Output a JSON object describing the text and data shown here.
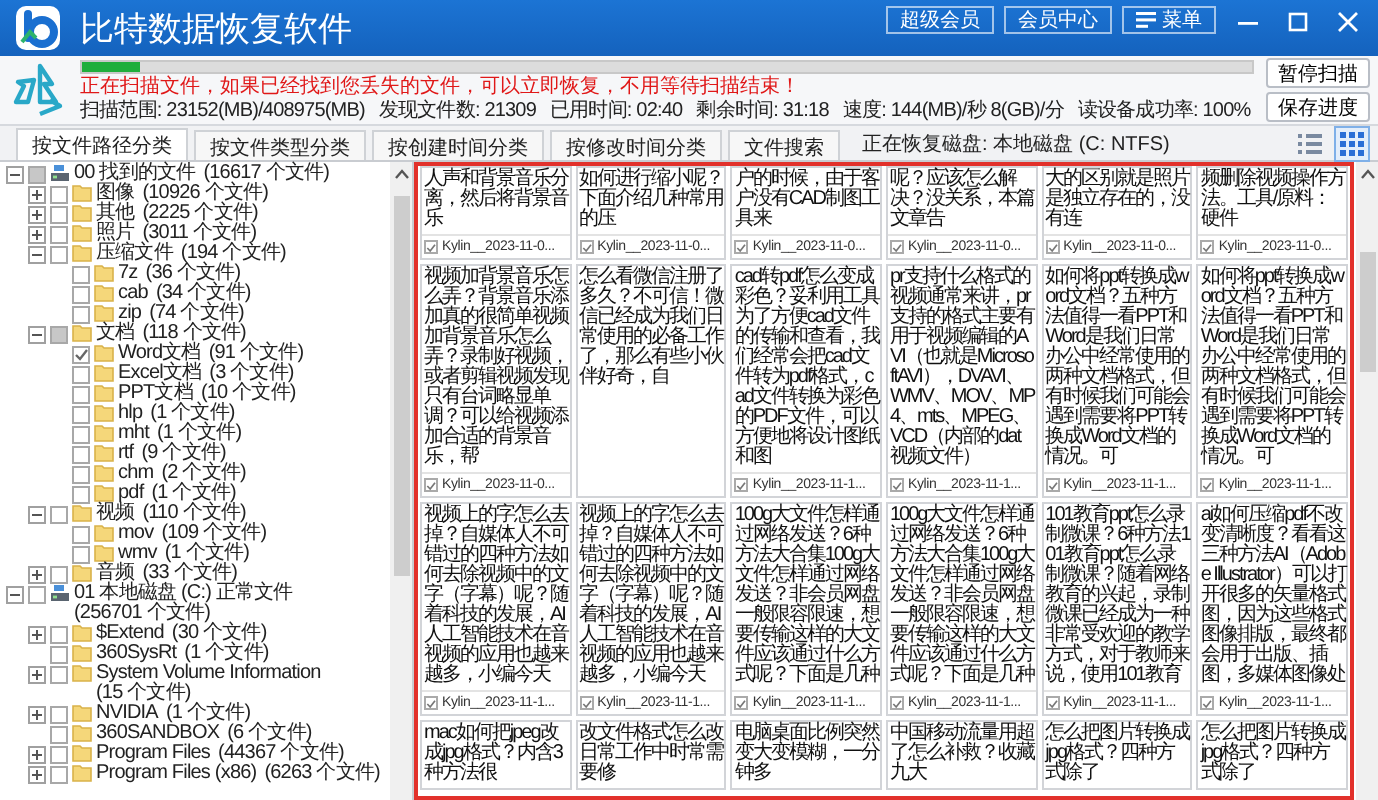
{
  "app": {
    "title": "比特数据恢复软件",
    "buttons": [
      {
        "label": "超级会员",
        "kind": "plain"
      },
      {
        "label": "会员中心",
        "kind": "plain"
      },
      {
        "label": "菜单",
        "kind": "menu"
      }
    ]
  },
  "scan": {
    "level": 0.05,
    "message": "正在扫描文件，如果已经找到您丢失的文件，可以立即恢复，不用等待扫描结束！",
    "stats": [
      "扫描范围: 23152(MB)/408975(MB)",
      "发现文件数: 21309",
      "已用时间: 02:40",
      "剩余时间: 31:18",
      "速度: 144(MB)/秒 8(GB)/分",
      "读设备成功率: 100%"
    ],
    "buttons": [
      "暂停扫描",
      "保存进度"
    ]
  },
  "tabs": [
    {
      "label": "按文件路径分类",
      "selected": true
    },
    {
      "label": "按文件类型分类",
      "selected": false
    },
    {
      "label": "按创建时间分类",
      "selected": false
    },
    {
      "label": "按修改时间分类",
      "selected": false
    },
    {
      "label": "文件搜索",
      "selected": false
    }
  ],
  "disk_status": "正在恢复磁盘: 本地磁盘 (C: NTFS)",
  "view_modes": [
    {
      "kind": "list",
      "selected": false
    },
    {
      "kind": "grid",
      "selected": true
    }
  ],
  "tree": [
    {
      "label": "00 找到的文件",
      "count": "(16617 个文件)",
      "kind": "drive",
      "checked": false,
      "partial": true,
      "expanded": true,
      "children": [
        {
          "label": "图像",
          "count": "(10926 个文件)",
          "kind": "folder",
          "checked": false,
          "partial": false,
          "expanded": false
        },
        {
          "label": "其他",
          "count": "(2225 个文件)",
          "kind": "folder",
          "checked": false,
          "partial": false,
          "expanded": false
        },
        {
          "label": "照片",
          "count": "(3011 个文件)",
          "kind": "folder",
          "checked": false,
          "partial": false,
          "expanded": false
        },
        {
          "label": "压缩文件",
          "count": "(194 个文件)",
          "kind": "folder",
          "checked": false,
          "partial": false,
          "expanded": true,
          "children": [
            {
              "label": "7z",
              "count": "(36 个文件)",
              "kind": "folder",
              "checked": false,
              "partial": false
            },
            {
              "label": "cab",
              "count": "(34 个文件)",
              "kind": "folder",
              "checked": false,
              "partial": false
            },
            {
              "label": "zip",
              "count": "(74 个文件)",
              "kind": "folder",
              "checked": false,
              "partial": false
            }
          ]
        },
        {
          "label": "文档",
          "count": "(118 个文件)",
          "kind": "folder",
          "checked": false,
          "partial": true,
          "expanded": true,
          "children": [
            {
              "label": "Word文档",
              "count": "(91 个文件)",
              "kind": "folder",
              "checked": true,
              "partial": false
            },
            {
              "label": "Excel文档",
              "count": "(3 个文件)",
              "kind": "folder",
              "checked": false,
              "partial": false
            },
            {
              "label": "PPT文档",
              "count": "(10 个文件)",
              "kind": "folder",
              "checked": false,
              "partial": false
            },
            {
              "label": "hlp",
              "count": "(1 个文件)",
              "kind": "folder",
              "checked": false,
              "partial": false
            },
            {
              "label": "mht",
              "count": "(1 个文件)",
              "kind": "folder",
              "checked": false,
              "partial": false
            },
            {
              "label": "rtf",
              "count": "(9 个文件)",
              "kind": "folder",
              "checked": false,
              "partial": false
            },
            {
              "label": "chm",
              "count": "(2 个文件)",
              "kind": "folder",
              "checked": false,
              "partial": false
            },
            {
              "label": "pdf",
              "count": "(1 个文件)",
              "kind": "folder",
              "checked": false,
              "partial": false
            }
          ]
        },
        {
          "label": "视频",
          "count": "(110 个文件)",
          "kind": "folder",
          "checked": false,
          "partial": false,
          "expanded": true,
          "children": [
            {
              "label": "mov",
              "count": "(109 个文件)",
              "kind": "folder",
              "checked": false,
              "partial": false
            },
            {
              "label": "wmv",
              "count": "(1 个文件)",
              "kind": "folder",
              "checked": false,
              "partial": false
            }
          ]
        },
        {
          "label": "音频",
          "count": "(33 个文件)",
          "kind": "folder",
          "checked": false,
          "partial": false,
          "expanded": false
        }
      ]
    },
    {
      "label": "01 本地磁盘 (C:) 正常文件",
      "count": "(256701 个文件)",
      "kind": "drive",
      "checked": false,
      "partial": false,
      "expanded": true,
      "children": [
        {
          "label": "$Extend",
          "count": "(30 个文件)",
          "kind": "folder",
          "checked": false,
          "partial": false,
          "expanded": false
        },
        {
          "label": "360SysRt",
          "count": "(1 个文件)",
          "kind": "folder",
          "checked": false,
          "partial": false
        },
        {
          "label": "System Volume Information",
          "count": "(15 个文件)",
          "kind": "folder",
          "checked": false,
          "partial": false,
          "expanded": false
        },
        {
          "label": "NVIDIA",
          "count": "(1 个文件)",
          "kind": "folder",
          "checked": false,
          "partial": false,
          "expanded": false
        },
        {
          "label": "360SANDBOX",
          "count": "(6 个文件)",
          "kind": "folder",
          "checked": false,
          "partial": false
        },
        {
          "label": "Program Files",
          "count": "(44367 个文件)",
          "kind": "folder",
          "checked": false,
          "partial": false,
          "expanded": false
        },
        {
          "label": "Program Files (x86)",
          "count": "(6263 个文件)",
          "kind": "folder",
          "checked": false,
          "partial": false,
          "expanded": false
        }
      ]
    }
  ],
  "cards": [
    {
      "text": "人声和背景音乐分离，然后将背景音乐",
      "footer": "Kylin__2023-11-0...",
      "checked": true
    },
    {
      "text": "如何进行缩小呢？下面介绍几种常用的压",
      "footer": "Kylin__2023-11-0...",
      "checked": true
    },
    {
      "text": "户的时候，由于客户没有CAD制图工具来",
      "footer": "Kylin__2023-11-0...",
      "checked": true
    },
    {
      "text": "呢？应该怎么解决？没关系，本篇文章告",
      "footer": "Kylin__2023-11-0...",
      "checked": true
    },
    {
      "text": "大的区别就是照片是独立存在的，没有连",
      "footer": "Kylin__2023-11-0...",
      "checked": true
    },
    {
      "text": "频删除视频操作方法。工具/原料：硬件",
      "footer": "Kylin__2023-11-0...",
      "checked": true
    },
    {
      "text": "视频加背景音乐怎么弄？背景音乐添加真的很简单视频加背景音乐怎么弄？录制好视频，或者剪辑视频发现只有台词略显单调？可以给视频添加合适的背景音乐，帮",
      "footer": "Kylin__2023-11-0...",
      "checked": true
    },
    {
      "text": "怎么看微信注册了多久？不可信！微信已经成为我们日常使用的必备工作了，那么有些小伙伴好奇，自"
    },
    {
      "text": "cad转pdf怎么变成彩色？妥利用工具为了方便cad文件的传输和查看，我们经常会把cad文件转为pdf格式，cad文件转换为彩色的PDF文件，可以方便地将设计图纸和图",
      "footer": "Kylin__2023-11-1...",
      "checked": true
    },
    {
      "text": "pr支持什么格式的视频通常来讲，pr支持的格式主要有用于视频编辑的AVI（也就是MicrosoftAVI），DVAVI、WMV、MOV、MP4、mts、MPEG、VCD（内部的dat视频文件）",
      "footer": "Kylin__2023-11-1...",
      "checked": true
    },
    {
      "text": "如何将ppt转换成word文档？五种方法值得一看PPT和Word是我们日常办公中经常使用的两种文档格式，但有时候我们可能会遇到需要将PPT转换成Word文档的情况。可",
      "footer": "Kylin__2023-11-1...",
      "checked": true
    },
    {
      "text": "如何将ppt转换成word文档？五种方法值得一看PPT和Word是我们日常办公中经常使用的两种文档格式，但有时候我们可能会遇到需要将PPT转换成Word文档的情况。可",
      "footer": "Kylin__2023-11-1...",
      "checked": true
    },
    {
      "text": "视频上的字怎么去掉？自媒体人不可错过的四种方法如何去除视频中的文字（字幕）呢？随着科技的发展，AI人工智能技术在音视频的应用也越来越多，小编今天",
      "footer": "Kylin__2023-11-1...",
      "checked": true
    },
    {
      "text": "视频上的字怎么去掉？自媒体人不可错过的四种方法如何去除视频中的文字（字幕）呢？随着科技的发展，AI人工智能技术在音视频的应用也越来越多，小编今天",
      "footer": "Kylin__2023-11-1...",
      "checked": true
    },
    {
      "text": "100g大文件怎样通过网络发送？6种方法大合集100g大文件怎样通过网络发送？非会员网盘一般限容限速，想要传输这样的大文件应该通过什么方式呢？下面是几种",
      "footer": "Kylin__2023-11-1...",
      "checked": true
    },
    {
      "text": "100g大文件怎样通过网络发送？6种方法大合集100g大文件怎样通过网络发送？非会员网盘一般限容限速，想要传输这样的大文件应该通过什么方式呢？下面是几种",
      "footer": "Kylin__2023-11-1...",
      "checked": true
    },
    {
      "text": "101教育ppt怎么录制微课？6种方法101教育ppt怎么录制微课？随着网络教育的兴起，录制微课已经成为一种非常受欢迎的教学方式，对于教师来说，使用101教育",
      "footer": "Kylin__2023-11-1...",
      "checked": true
    },
    {
      "text": "ai如何压缩pdf不改变清晰度？看看这三种方法AI（Adobe Illustrator）可以打开很多的矢量格式图，因为这些格式图像排版，最终都会用于出版、插图，多媒体图像处",
      "footer": "Kylin__2023-11-1...",
      "checked": true
    },
    {
      "text": "mac如何把jpeg改成jpg格式？内含3种方法很"
    },
    {
      "text": "改文件格式怎么改日常工作中时常需要修"
    },
    {
      "text": "电脑桌面比例突然变大变模糊，一分钟多"
    },
    {
      "text": "中国移动流量用超了怎么补救？收藏九大"
    },
    {
      "text": "怎么把图片转换成jpg格式？四种方式除了"
    },
    {
      "text": "怎么把图片转换成jpg格式？四种方式除了"
    }
  ]
}
